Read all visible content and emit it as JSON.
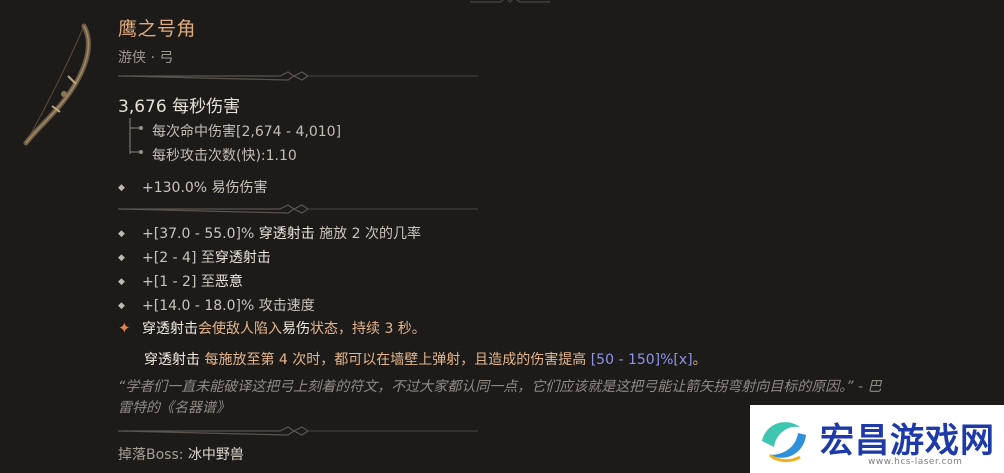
{
  "item": {
    "name": "鹰之号角",
    "type_line": "游侠 · 弓",
    "dps": "3,676 每秒伤害",
    "damage_per_hit": "每次命中伤害[2,674 - 4,010]",
    "attacks_per_second": "每秒攻击次数(快):1.10",
    "implicit": "+130.0% 易伤伤害",
    "affixes": [
      {
        "prefix": "+[37.0 - 55.0]% ",
        "keyword": "穿透射击",
        "suffix": " 施放 2 次的几率"
      },
      {
        "prefix": "+[2 - 4] 至",
        "keyword": "穿透射击",
        "suffix": ""
      },
      {
        "prefix": "+[1 - 2] 至",
        "keyword": "恶意",
        "suffix": ""
      },
      {
        "prefix": "+[14.0 - 18.0]% 攻击速度",
        "keyword": "",
        "suffix": ""
      }
    ],
    "legendary": {
      "keyword1": "穿透射击",
      "text1": "会使敌人陷入",
      "keyword2": "易伤",
      "text2": "状态，持续 3 秒。"
    },
    "legendary_extra": {
      "keyword": "穿透射击",
      "text": " 每施放至第 4 次时，都可以在墙壁上弹射，且造成的伤害提高 ",
      "range": "[50 - 150]%[x]",
      "end": "。"
    },
    "flavor": "“学者们一直未能破译这把弓上刻着的符文，不过大家都认同一点，它们应该就是这把弓能让箭矢拐弯射向目标的原因。” - 巴雷特的《名器谱》",
    "drop_label": "掉落Boss: ",
    "drop_boss": "冰中野兽"
  },
  "watermark": {
    "title": "宏昌游戏网",
    "url": "www.hcs-laser.com"
  },
  "colors": {
    "background": "#1d1b1a",
    "item_name": "#e0ab7a",
    "legendary_text": "#e4b58a",
    "range_blue": "#8d95e8",
    "watermark_blue": "#1e3aa8"
  },
  "icons": [
    "bow-icon",
    "diamond-bullet-icon",
    "legendary-star-icon",
    "divider-ornament-icon",
    "watermark-logo-icon"
  ]
}
